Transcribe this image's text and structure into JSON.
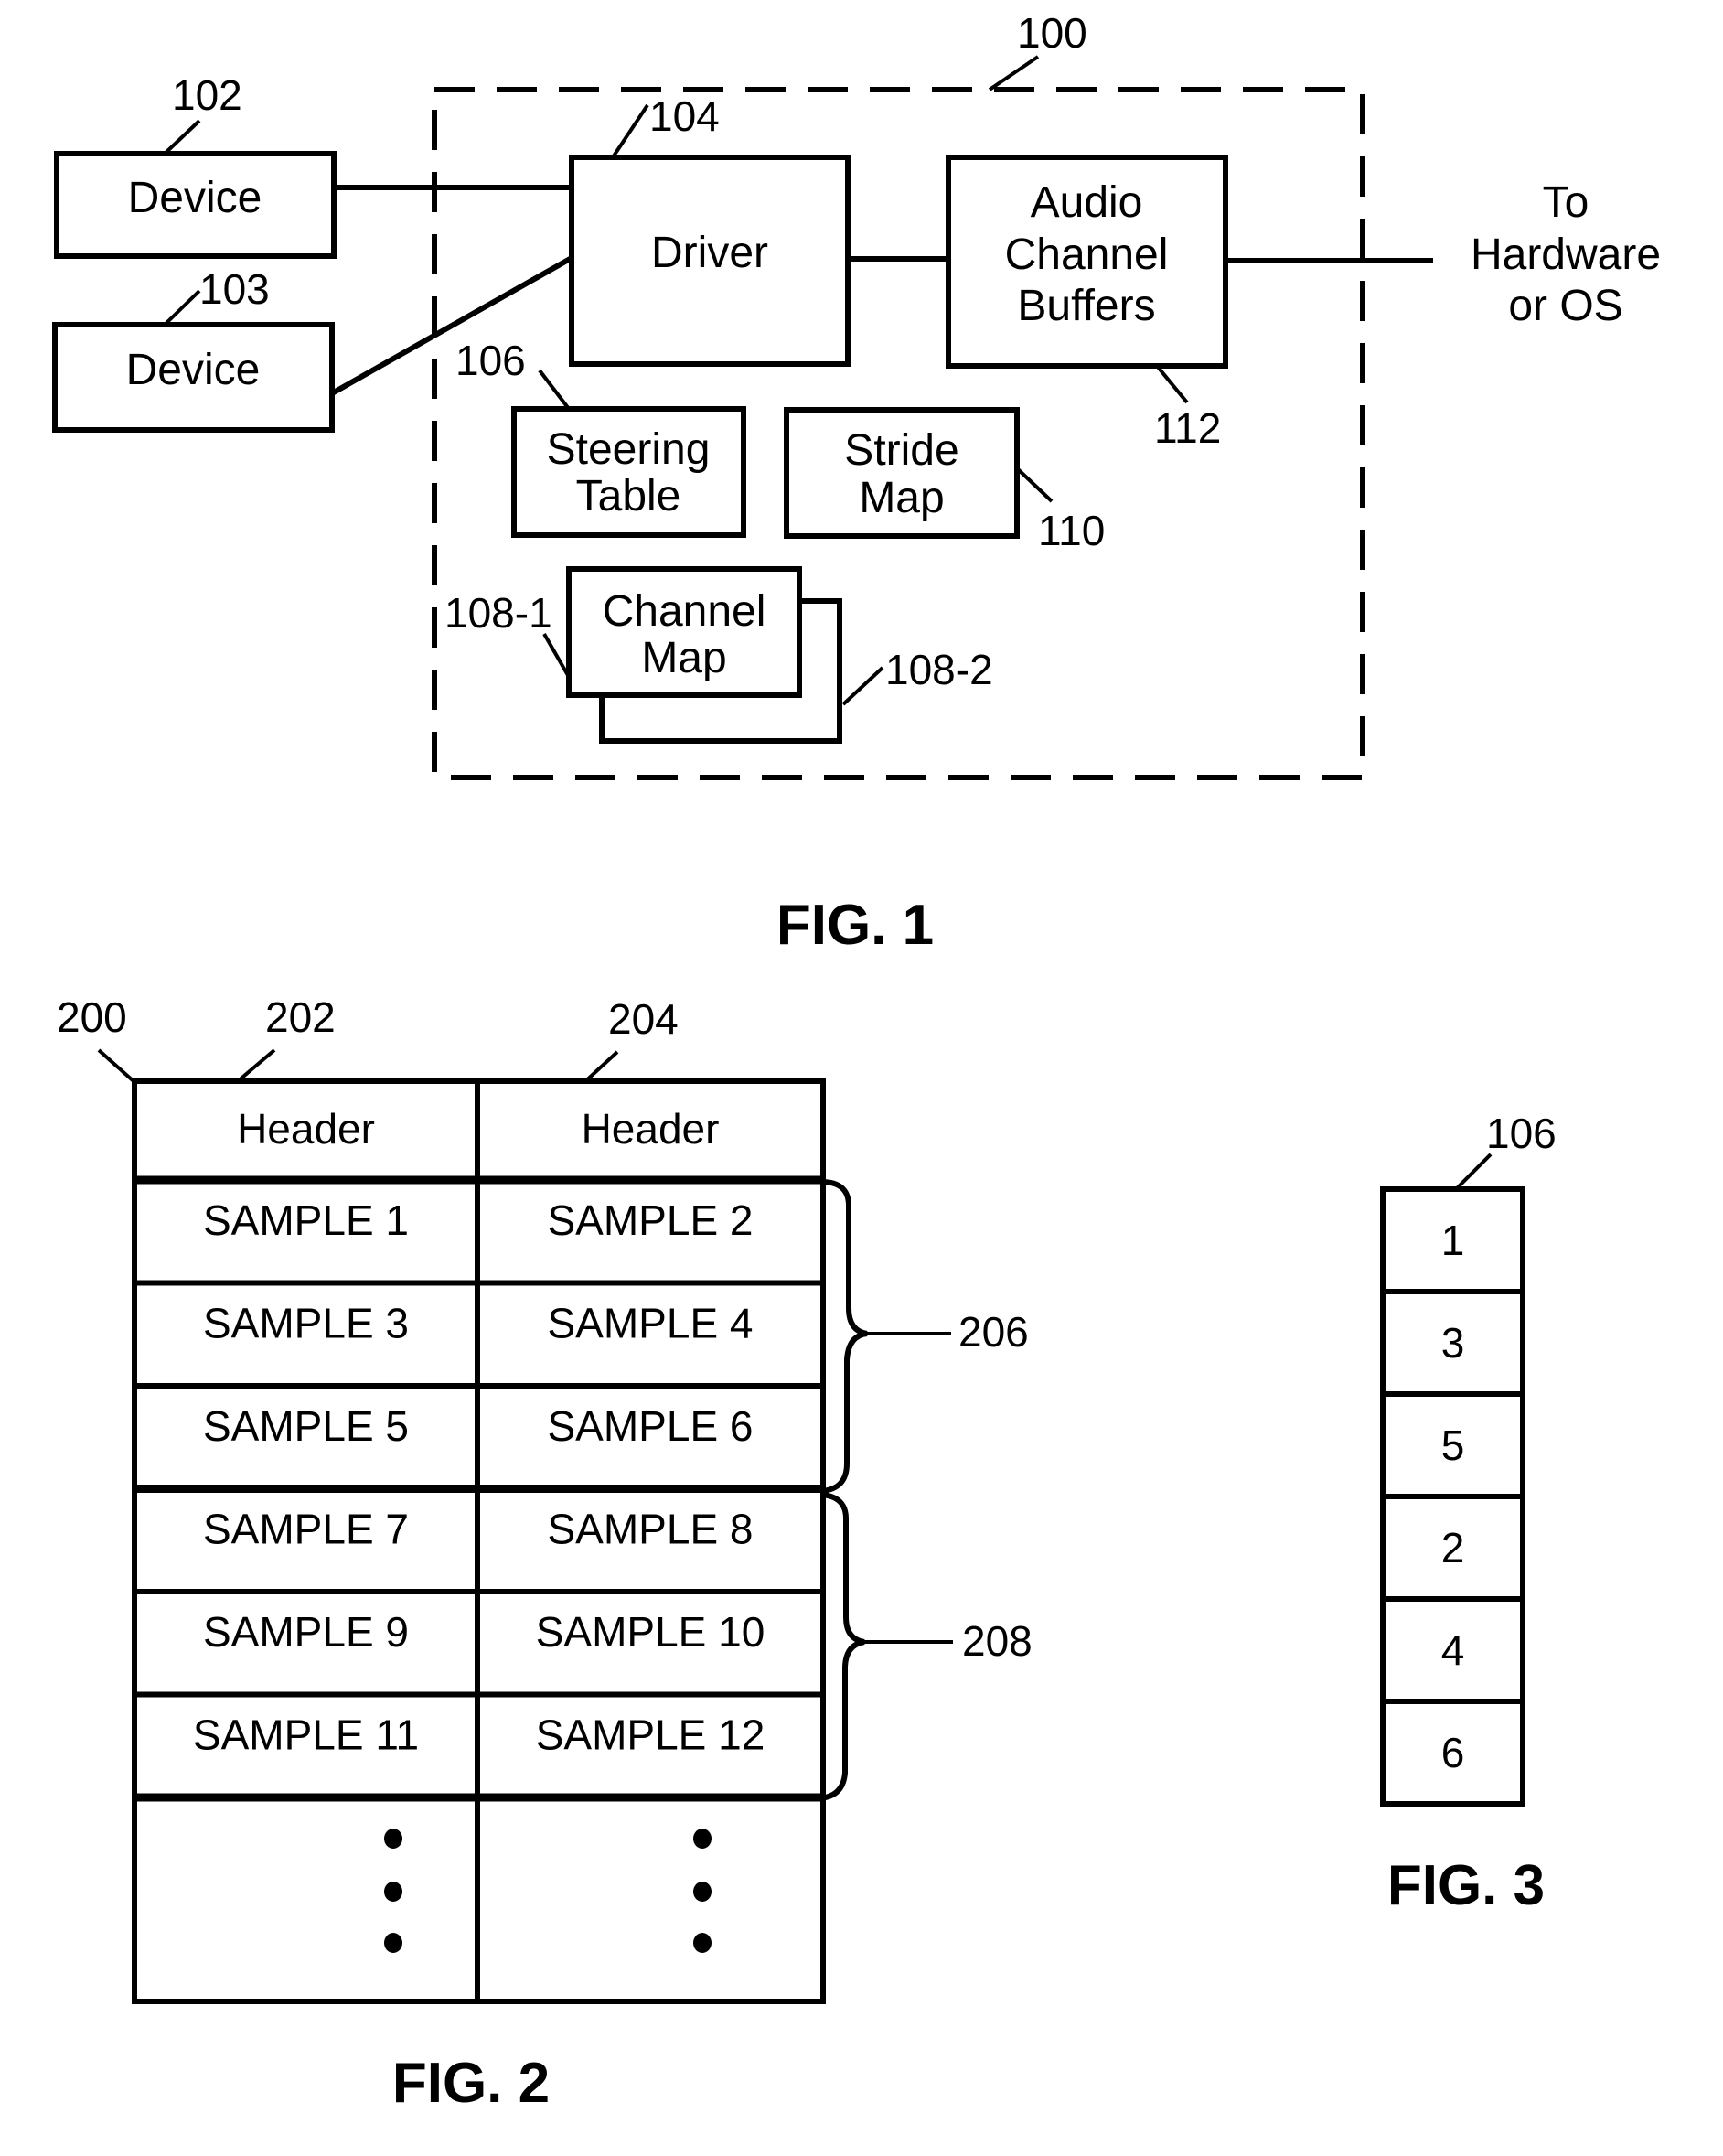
{
  "fig1": {
    "caption": "FIG. 1",
    "system": {
      "ref": "100"
    },
    "device_a": {
      "label": "Device",
      "ref": "102"
    },
    "device_b": {
      "label": "Device",
      "ref": "103"
    },
    "driver": {
      "label": "Driver",
      "ref": "104"
    },
    "buffers": {
      "lines": [
        "Audio",
        "Channel",
        "Buffers"
      ],
      "ref": "112"
    },
    "steering_table": {
      "lines": [
        "Steering",
        "Table"
      ],
      "ref": "106"
    },
    "stride_map": {
      "lines": [
        "Stride",
        "Map"
      ],
      "ref": "110"
    },
    "channel_map": {
      "lines": [
        "Channel",
        "Map"
      ],
      "ref_front": "108-1",
      "ref_back": "108-2"
    },
    "output": {
      "lines": [
        "To",
        "Hardware",
        "or OS"
      ]
    }
  },
  "fig2": {
    "caption": "FIG. 2",
    "refs": {
      "buffer": "200",
      "col1": "202",
      "col2": "204",
      "group1": "206",
      "group2": "208"
    },
    "headers": [
      "Header",
      "Header"
    ],
    "rows": [
      [
        "SAMPLE 1",
        "SAMPLE 2"
      ],
      [
        "SAMPLE 3",
        "SAMPLE 4"
      ],
      [
        "SAMPLE 5",
        "SAMPLE 6"
      ],
      [
        "SAMPLE 7",
        "SAMPLE 8"
      ],
      [
        "SAMPLE 9",
        "SAMPLE 10"
      ],
      [
        "SAMPLE 11",
        "SAMPLE 12"
      ]
    ]
  },
  "fig3": {
    "caption": "FIG. 3",
    "ref": "106",
    "entries": [
      "1",
      "3",
      "5",
      "2",
      "4",
      "6"
    ]
  }
}
